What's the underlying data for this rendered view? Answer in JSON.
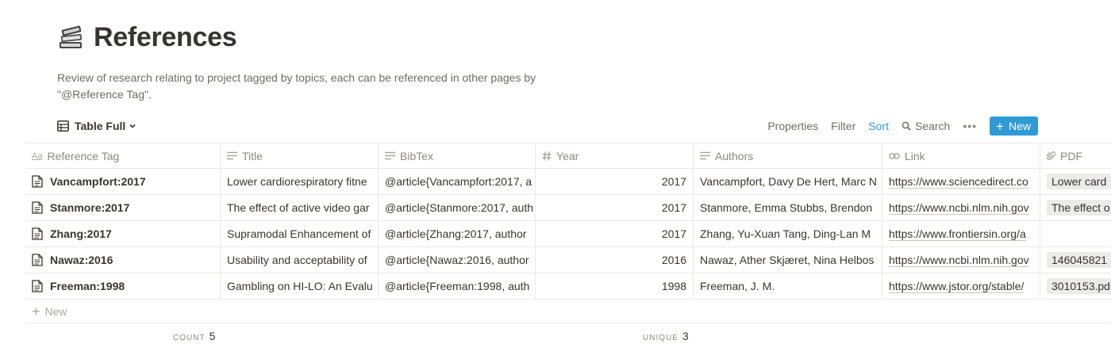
{
  "page": {
    "icon": "books-icon",
    "title": "References",
    "description": "Review of research relating to project tagged by topics, each can be referenced in other pages by \"@Reference Tag\"."
  },
  "view_bar": {
    "view_name": "Table Full",
    "properties": "Properties",
    "filter": "Filter",
    "sort": "Sort",
    "search": "Search",
    "more": "•••",
    "new_label": "New",
    "accent_color": "#2e9bd6"
  },
  "table": {
    "columns": [
      {
        "label": "Reference Tag",
        "icon": "title-aa-icon"
      },
      {
        "label": "Title",
        "icon": "text-lines-icon"
      },
      {
        "label": "BibTex",
        "icon": "text-lines-icon"
      },
      {
        "label": "Year",
        "icon": "hash-icon"
      },
      {
        "label": "Authors",
        "icon": "text-lines-icon"
      },
      {
        "label": "Link",
        "icon": "link-icon"
      },
      {
        "label": "PDF",
        "icon": "paperclip-icon"
      }
    ],
    "rows": [
      {
        "tag": "Vancampfort:2017",
        "title": "Lower cardiorespiratory fitne",
        "bibtex": "@article{Vancampfort:2017, a",
        "year": "2017",
        "authors": "Vancampfort, Davy De Hert, Marc N",
        "link": "https://www.sciencedirect.co",
        "pdf": "Lower card"
      },
      {
        "tag": "Stanmore:2017",
        "title": "The effect of active video gar",
        "bibtex": "@article{Stanmore:2017, auth",
        "year": "2017",
        "authors": "Stanmore, Emma Stubbs, Brendon",
        "link": "https://www.ncbi.nlm.nih.gov",
        "pdf": "The effect o"
      },
      {
        "tag": "Zhang:2017",
        "title": "Supramodal Enhancement of",
        "bibtex": "@article{Zhang:2017, author",
        "year": "2017",
        "authors": "Zhang, Yu-Xuan Tang, Ding-Lan M",
        "link": "https://www.frontiersin.org/a",
        "pdf": ""
      },
      {
        "tag": "Nawaz:2016",
        "title": "Usability and acceptability of",
        "bibtex": "@article{Nawaz:2016, author",
        "year": "2016",
        "authors": "Nawaz, Ather Skjæret, Nina Helbos",
        "link": "https://www.ncbi.nlm.nih.gov",
        "pdf": "146045821"
      },
      {
        "tag": "Freeman:1998",
        "title": "Gambling on HI-LO: An Evalu",
        "bibtex": "@article{Freeman:1998, auth",
        "year": "1998",
        "authors": "Freeman, J. M.",
        "link": "https://www.jstor.org/stable/",
        "pdf": "3010153.pd"
      }
    ],
    "new_row_label": "New"
  },
  "footer": {
    "count_label": "COUNT",
    "count_value": "5",
    "unique_label": "UNIQUE",
    "unique_value": "3"
  }
}
